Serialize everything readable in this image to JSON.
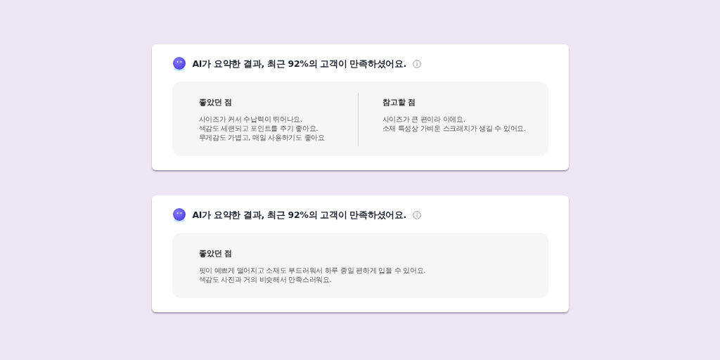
{
  "cards": [
    {
      "title": "AI가 요약한 결과, 최근 92%의 고객이 만족하셨어요.",
      "sections": [
        {
          "heading": "좋았던 점",
          "lines": [
            "사이즈가 커서 수납력이 뛰어나요.",
            "색감도 세련되고 포인트를 주기 좋아요.",
            "무게감도 가볍고, 매일 사용하기도 좋아요"
          ]
        },
        {
          "heading": "참고할 점",
          "lines": [
            "사이즈가 큰 편이라 이에요.",
            "소재 특성상 가벼운 스크래치가 생길 수 있어요."
          ]
        }
      ]
    },
    {
      "title": "AI가 요약한 결과, 최근 92%의 고객이 만족하셨어요.",
      "sections": [
        {
          "heading": "좋았던 점",
          "lines": [
            "핏이 예쁘게 떨어지고 소재도 부드러워서 하루 종일 편하게 입을 수 있어요.",
            "색감도 사진과 거의 비슷해서 만족스러워요."
          ]
        }
      ]
    }
  ]
}
